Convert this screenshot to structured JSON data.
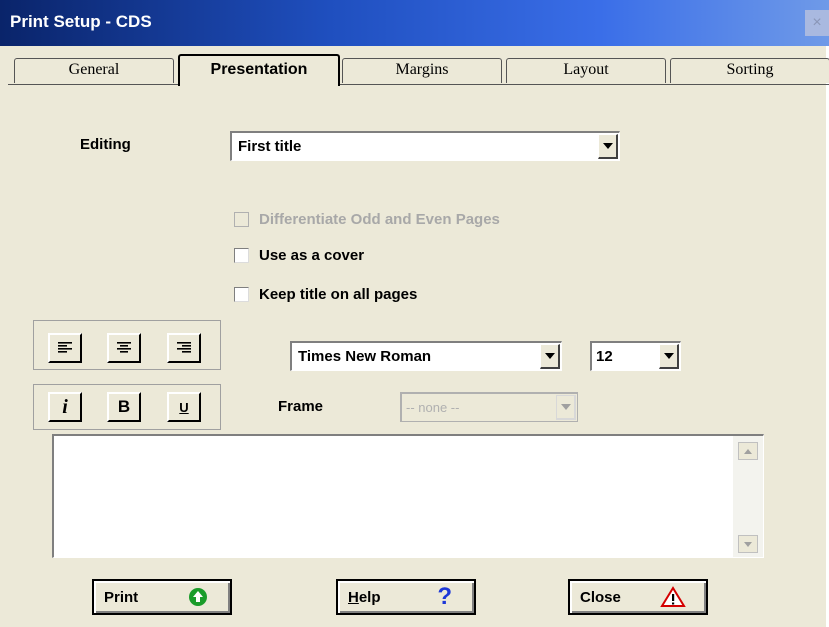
{
  "window": {
    "title": "Print Setup - CDS",
    "close_glyph": "×"
  },
  "tabs": [
    {
      "label": "General"
    },
    {
      "label": "Presentation",
      "active": true
    },
    {
      "label": "Margins"
    },
    {
      "label": "Layout"
    },
    {
      "label": "Sorting"
    }
  ],
  "editing": {
    "label": "Editing",
    "value": "First title"
  },
  "checkboxes": {
    "odd_even": {
      "label": "Differentiate Odd and Even Pages",
      "checked": false,
      "enabled": false
    },
    "cover": {
      "label": "Use as a cover",
      "checked": false,
      "enabled": true
    },
    "keep_title": {
      "label": "Keep title on all pages",
      "checked": false,
      "enabled": true
    }
  },
  "font": {
    "family": "Times New Roman",
    "size": "12"
  },
  "style_buttons": {
    "italic": "i",
    "bold": "B",
    "underline": "U"
  },
  "frame": {
    "label": "Frame",
    "value": "-- none --"
  },
  "buttons": {
    "print": {
      "label": "Print"
    },
    "help": {
      "label_rest": "elp",
      "accel": "H",
      "glyph": "?"
    },
    "close": {
      "label": "Close",
      "glyph": "!"
    }
  },
  "colors": {
    "titlebar": "#0a246a",
    "print_icon": "#1a9c2a",
    "help_icon": "#1d38d8",
    "warn_icon": "#d40000"
  }
}
